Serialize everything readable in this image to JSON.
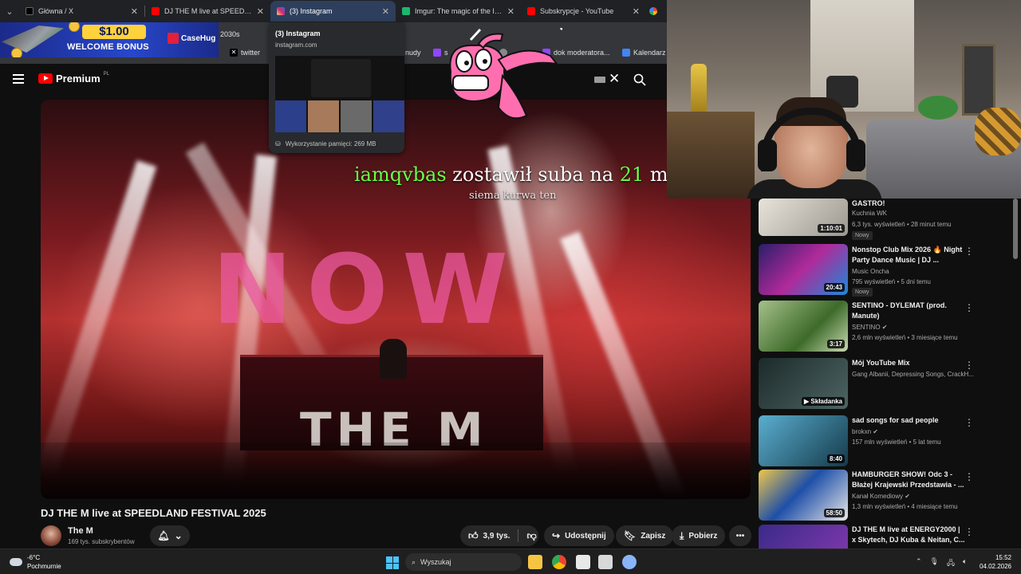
{
  "browser": {
    "tabs": [
      {
        "label": "Główna / X",
        "favicon_color": "#000000",
        "active": false
      },
      {
        "label": "DJ THE M live at SPEEDLAND FE",
        "favicon_color": "#ff0000",
        "active": false
      },
      {
        "label": "(3) Instagram",
        "favicon_color": "#d62976",
        "active": true
      },
      {
        "label": "Imgur: The magic of the Interne",
        "favicon_color": "#1bb76e",
        "active": false
      },
      {
        "label": "Subskrypcje - YouTube",
        "favicon_color": "#ff0000",
        "active": false
      }
    ],
    "bookmarks": {
      "top_partial": "2030s",
      "items": [
        "twitter",
        "nudy",
        "s",
        "dok moderatora...",
        "Kalendarz G"
      ]
    }
  },
  "ad": {
    "amount": "$1.00",
    "text": "WELCOME BONUS",
    "brand": "CaseHug"
  },
  "hover_card": {
    "title": "(3) Instagram",
    "url": "instagram.com",
    "memory": "Wykorzystanie pamięci: 269 MB"
  },
  "youtube": {
    "logo_text": "Premium",
    "logo_region": "PL",
    "video": {
      "overlay_big": "NOW",
      "overlay_small": "THE M",
      "title": "DJ THE M live at SPEEDLAND FESTIVAL 2025",
      "channel": "The M",
      "subscribers": "169 tys. subskrybentów",
      "likes": "3,9 tys.",
      "share": "Udostępnij",
      "save": "Zapisz",
      "download": "Pobierz"
    },
    "recommendations": [
      {
        "title": "GASTRO!",
        "channel": "Kuchnia WK",
        "meta": "6,3 tys. wyświetleń • 28 minut temu",
        "duration": "1:10:01",
        "badge": "Nowy",
        "color": "#d9d6cf"
      },
      {
        "title": "Nonstop Club Mix 2026 🔥 Night Party Dance Music | DJ ...",
        "channel": "Music Oncha",
        "meta": "795 wyświetleń • 5 dni temu",
        "duration": "20:43",
        "badge": "Nowy",
        "color": "#5b2a8a"
      },
      {
        "title": "SENTINO - DYLEMAT (prod. Manute)",
        "channel": "SENTINO",
        "meta": "2,6 mln wyświetleń • 3 miesiące temu",
        "duration": "3:17",
        "badge": "",
        "color": "#4d7a3a"
      },
      {
        "title": "Mój YouTube Mix",
        "channel": "Gang Albanii, Depressing Songs, CrackH...",
        "meta": "",
        "duration": "Składanka",
        "badge": "",
        "color": "#2f3e3c"
      },
      {
        "title": "sad songs for sad people",
        "channel": "brokxn",
        "meta": "157 mln wyświetleń • 5 lat temu",
        "duration": "8:40",
        "badge": "",
        "color": "#1d3a4a"
      },
      {
        "title": "HAMBURGER SHOW!  Odc 3 - Błażej Krajewski Przedstawia - ...",
        "channel": "Kanał Komediowy",
        "meta": "1,3 mln wyświetleń • 4 miesiące temu",
        "duration": "58:50",
        "badge": "",
        "color": "#1e4fa8"
      },
      {
        "title": "DJ THE M live at ENERGY2000 | x Skytech, DJ Kuba & Neitan, C...",
        "channel": "",
        "meta": "",
        "duration": "",
        "badge": "",
        "color": "#3a2a8a"
      }
    ]
  },
  "stream_overlay": {
    "alert_user": "iamqvbas",
    "alert_mid": " zostawił suba na ",
    "alert_num": "21",
    "alert_end": " miesiąc!",
    "message": "siema kurwa ten"
  },
  "taskbar": {
    "temperature": "-6°C",
    "condition": "Pochmurnie",
    "search": "Wyszukaj",
    "time": "15:52",
    "date": "04.02.2026"
  }
}
